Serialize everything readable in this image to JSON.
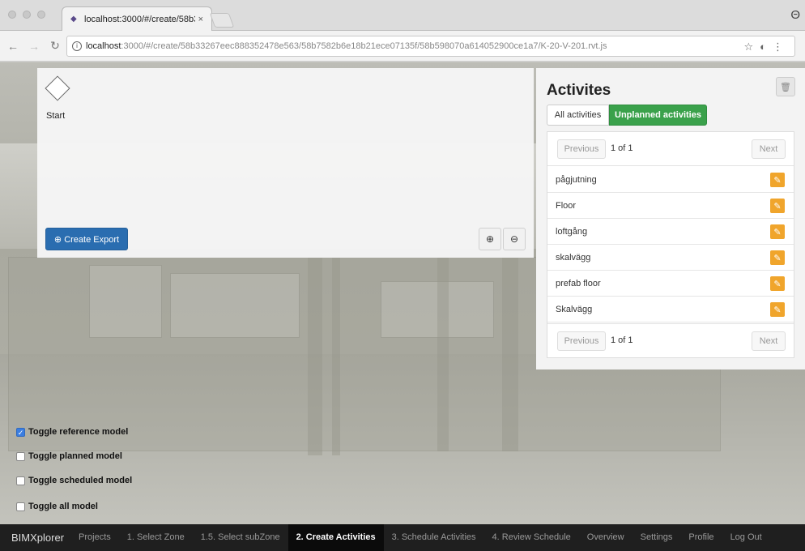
{
  "browser": {
    "tab_title": "localhost:3000/#/create/58b3",
    "tab_close": "×",
    "url_host": "localhost",
    "url_rest": ":3000/#/create/58b33267eec888352478e563/58b7582b6e18b21ece07135f/58b598070a614052900ce1a7/K-20-V-201.rvt.js"
  },
  "diagram": {
    "start_label": "Start",
    "export_label": "⊕ Create Export",
    "zoom_in": "⊕",
    "zoom_out": "⊖"
  },
  "activities": {
    "title": "Activites",
    "tab_all": "All activities",
    "tab_unplanned": "Unplanned activities",
    "pager_previous": "Previous",
    "pager_text": "1 of 1",
    "pager_next": "Next",
    "items": [
      {
        "name": "pågjutning"
      },
      {
        "name": "Floor"
      },
      {
        "name": "loftgång"
      },
      {
        "name": "skalvägg"
      },
      {
        "name": "prefab floor"
      },
      {
        "name": "Skalvägg"
      }
    ],
    "accent_color": "#3aa14b",
    "edit_color": "#f0a52c"
  },
  "toggles": [
    {
      "label": "Toggle reference model",
      "checked": true
    },
    {
      "label": "Toggle planned model",
      "checked": false
    },
    {
      "label": "Toggle scheduled model",
      "checked": false
    },
    {
      "label": "Toggle all model",
      "checked": false
    }
  ],
  "nav": {
    "brand": "BIMXplorer",
    "items": [
      {
        "label": "Projects",
        "active": false
      },
      {
        "label": "1. Select Zone",
        "active": false
      },
      {
        "label": "1.5. Select subZone",
        "active": false
      },
      {
        "label": "2. Create Activities",
        "active": true
      },
      {
        "label": "3. Schedule Activities",
        "active": false
      },
      {
        "label": "4. Review Schedule",
        "active": false
      },
      {
        "label": "Overview",
        "active": false
      },
      {
        "label": "Settings",
        "active": false
      },
      {
        "label": "Profile",
        "active": false
      },
      {
        "label": "Log Out",
        "active": false
      }
    ]
  }
}
